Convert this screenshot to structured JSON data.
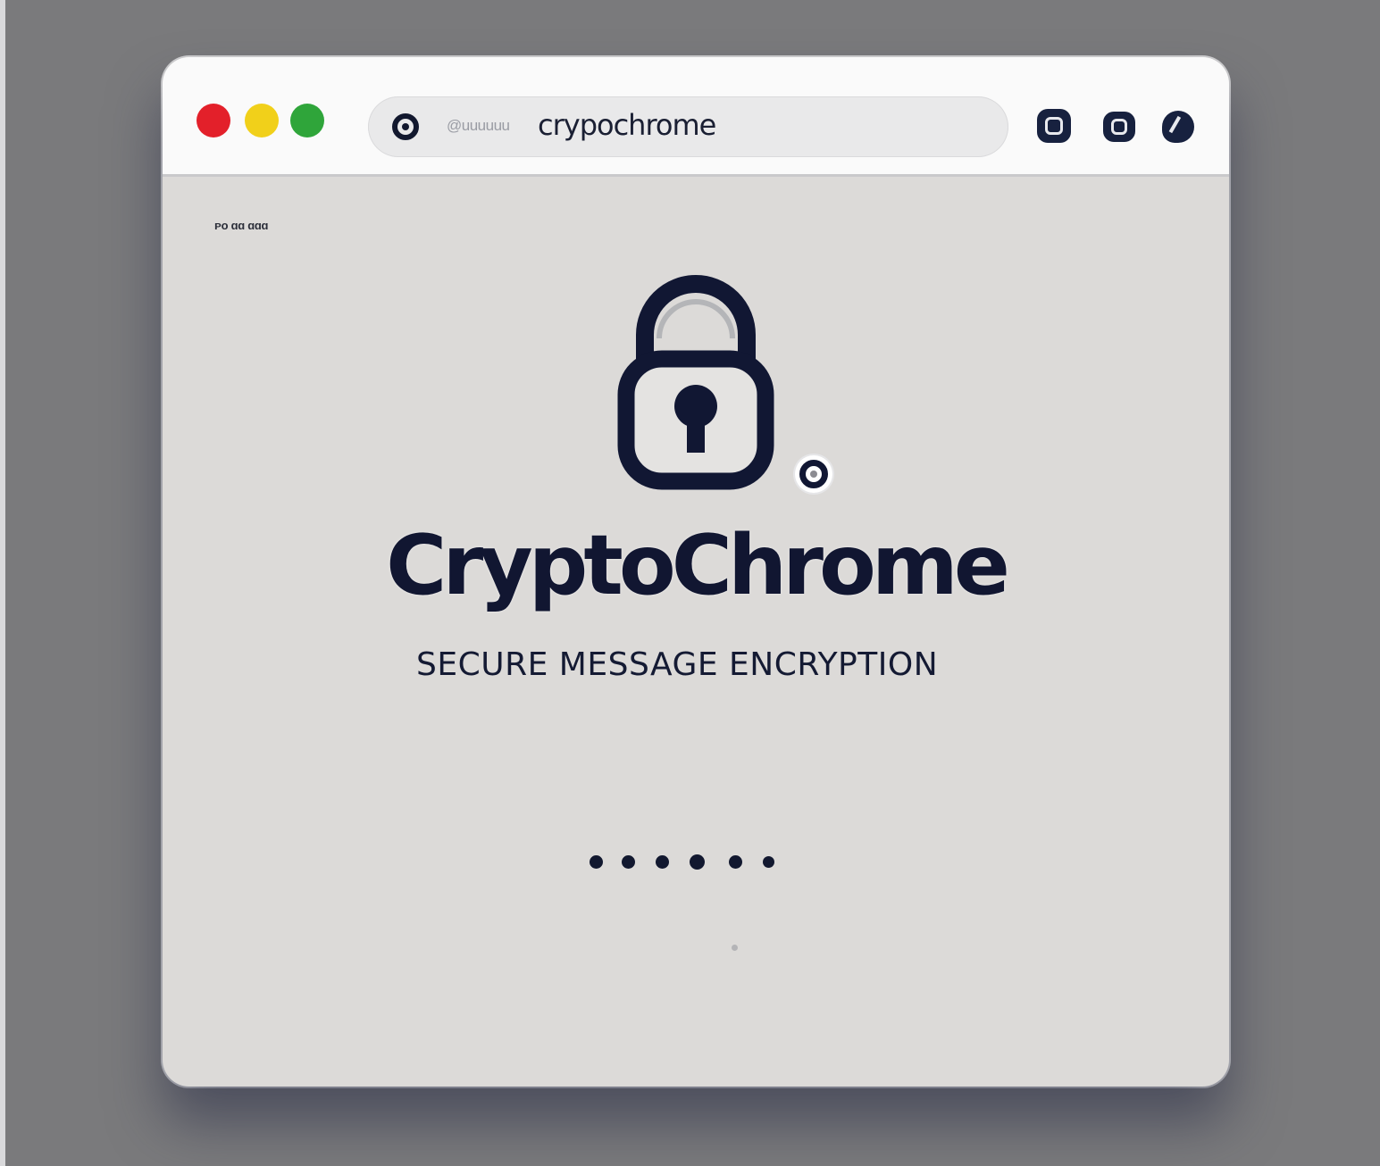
{
  "window": {
    "traffic_lights": [
      "close",
      "minimize",
      "maximize"
    ],
    "address_bar": {
      "icon": "site-info-icon",
      "prefix": "@uuuuuu",
      "url": "crypochrome"
    },
    "toolbar_icons": [
      "extension-icon",
      "tab-icon",
      "profile-icon"
    ]
  },
  "page": {
    "corner_label": "ᴘᴏ ɑɑ ɑɑɑ",
    "brand_title": "CryptoChrome",
    "tagline": "SECURE MESSAGE ENCRYPTION",
    "loader_dots": 6
  },
  "colors": {
    "background": "#7a7a7c",
    "window_content": "#dcdad8",
    "toolbar": "#fafafa",
    "brand_navy": "#111631",
    "close_red": "#e3202a",
    "minimize_yellow": "#f1d01a",
    "maximize_green": "#2fa53a"
  }
}
